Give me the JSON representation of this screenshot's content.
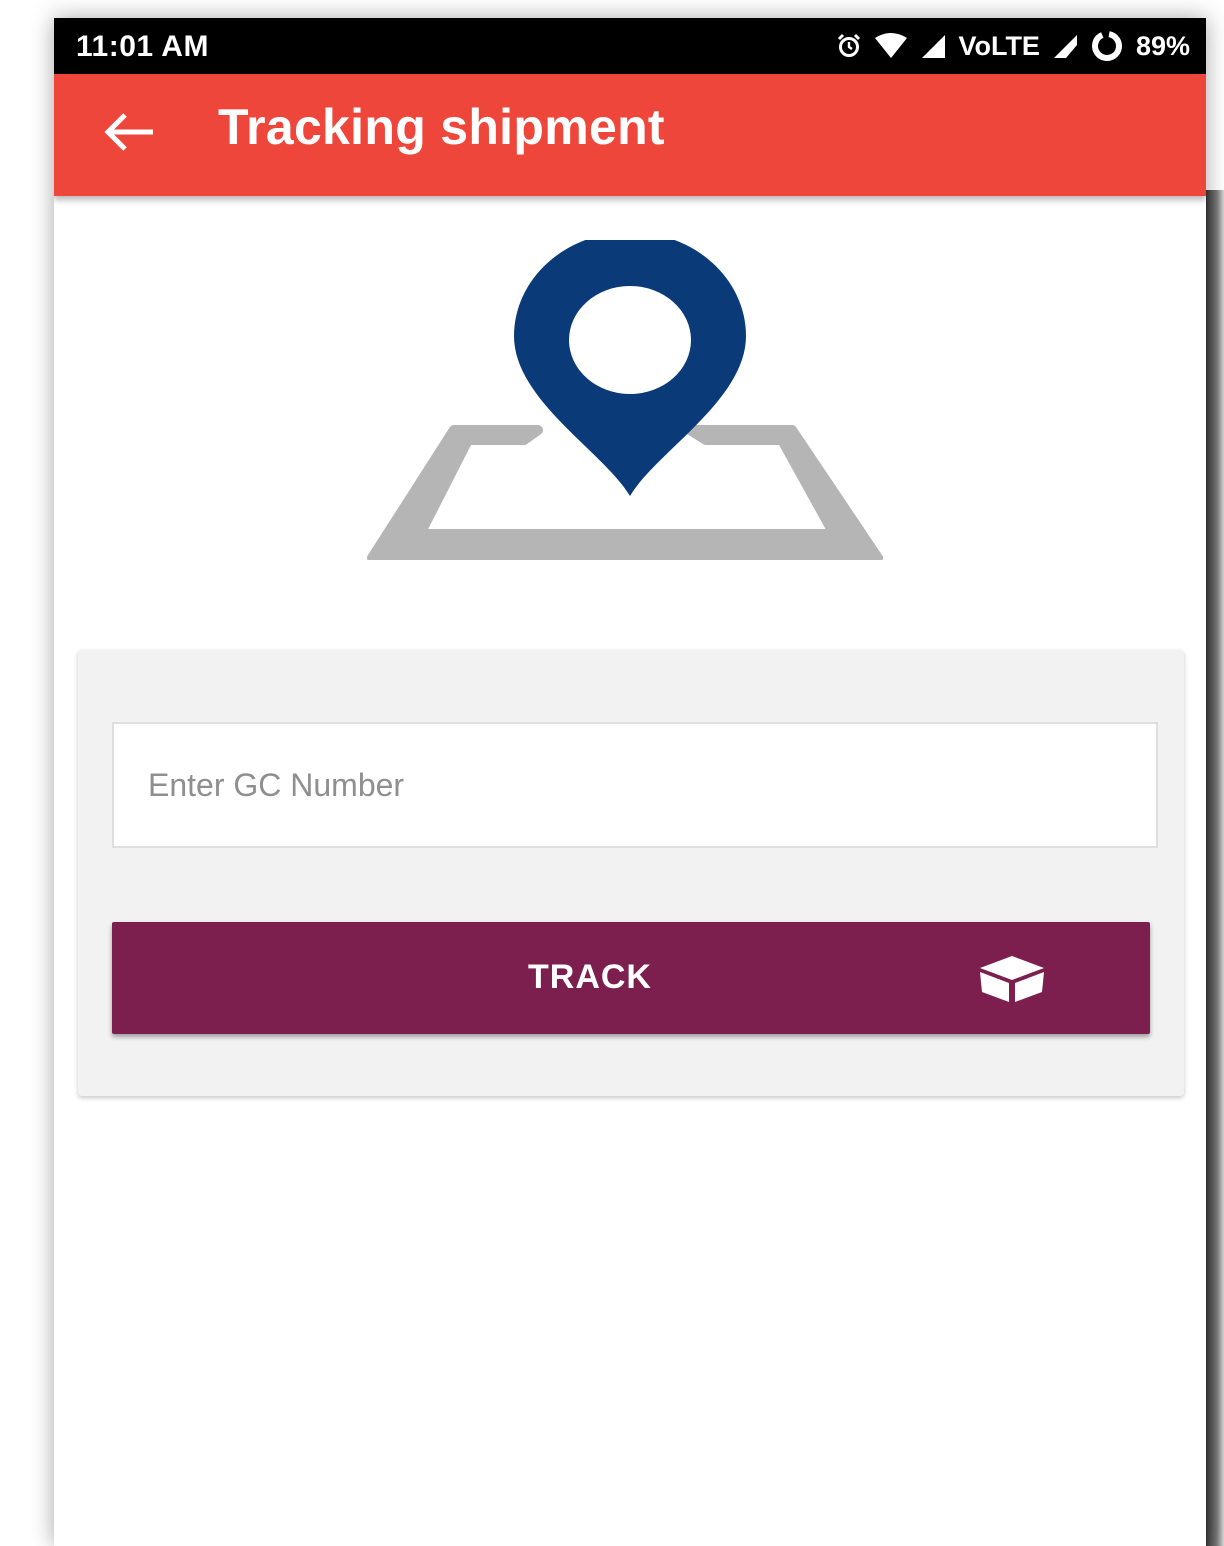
{
  "status_bar": {
    "time": "11:01 AM",
    "network": "VoLTE",
    "battery": "89%",
    "icons": [
      "alarm-icon",
      "wifi-icon",
      "signal-icon",
      "volte-label",
      "signal-icon",
      "battery-ring-icon"
    ]
  },
  "app_bar": {
    "title": "Tracking shipment",
    "back_icon": "arrow-left-icon",
    "color": "#ef463b"
  },
  "hero": {
    "icon": "map-location-pin-icon",
    "pin_color": "#0a3a78",
    "map_color": "#b5b5b5"
  },
  "form": {
    "gc_input": {
      "placeholder": "Enter GC Number",
      "value": ""
    },
    "track_button": {
      "label": "TRACK",
      "icon": "package-box-icon",
      "color": "#7c1f4f"
    }
  }
}
